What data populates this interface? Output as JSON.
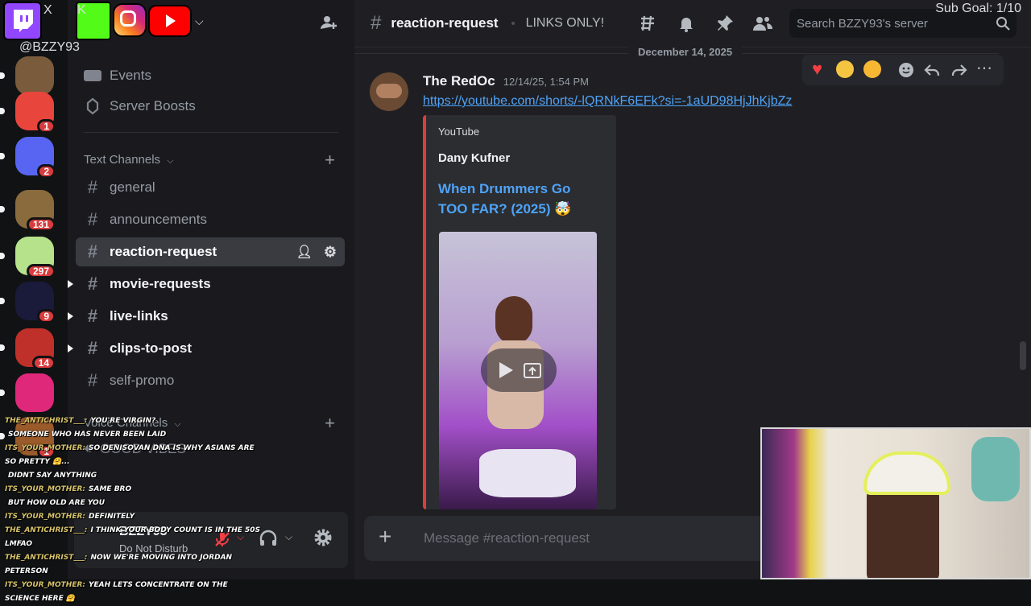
{
  "overlay": {
    "handle": "@BZZY93",
    "sub_goal": "Sub Goal: 1/10",
    "social_icons": [
      "twitch-icon",
      "x-icon",
      "kick-icon",
      "instagram-icon",
      "youtube-icon"
    ],
    "brand_colors": {
      "twitch": "#9146ff",
      "kick": "#53fc18",
      "instagram": "#e1306c",
      "youtube": "#ff0000",
      "sub_goal": "#f5e533"
    }
  },
  "servers": [
    {
      "badge": "",
      "color": "#7a5c3c"
    },
    {
      "badge": "1",
      "color": "#e8453c"
    },
    {
      "badge": "2",
      "color": "#5865f2"
    },
    {
      "badge": "131",
      "color": "#8a6b3d"
    },
    {
      "badge": "297",
      "color": "#b6e28c"
    },
    {
      "badge": "9",
      "color": "#1a1a3a"
    },
    {
      "badge": "14",
      "color": "#c0302a"
    },
    {
      "badge": "",
      "color": "#e0287a"
    },
    {
      "badge": "1",
      "color": "#9a5a2a"
    }
  ],
  "sidebar": {
    "top_items": [
      {
        "label": "Events"
      },
      {
        "label": "Server Boosts"
      }
    ],
    "text_category": "Text Channels",
    "voice_category": "Voice Channels",
    "voice_channel": "GOOD VIBES",
    "channels": [
      {
        "name": "general",
        "state": "muted"
      },
      {
        "name": "announcements",
        "state": "muted"
      },
      {
        "name": "reaction-request",
        "state": "active"
      },
      {
        "name": "movie-requests",
        "state": "unread"
      },
      {
        "name": "live-links",
        "state": "unread"
      },
      {
        "name": "clips-to-post",
        "state": "unread"
      },
      {
        "name": "self-promo",
        "state": "muted"
      }
    ],
    "user": {
      "name": "BZZY93",
      "status": "Do Not Disturb"
    }
  },
  "header": {
    "channel": "reaction-request",
    "topic": "LINKS ONLY!",
    "search_placeholder": "Search BZZY93's server"
  },
  "messages": {
    "date_divider": "December 14, 2025",
    "author": "The RedOc",
    "timestamp": "12/14/25, 1:54 PM",
    "link": "https://youtube.com/shorts/-lQRNkF6EFk?si=-1aUD98HjJhKjbZz",
    "reactions": [
      "heart-icon",
      "rofl-icon",
      "mind-blown-icon"
    ],
    "embed": {
      "provider": "YouTube",
      "author": "Dany Kufner",
      "title_line1": "When Drummers Go",
      "title_line2": "TOO FAR? (2025) 🤯"
    }
  },
  "composer": {
    "placeholder": "Message #reaction-request"
  },
  "chat_overlay": [
    {
      "user": "THE_ANTICHRIST___:",
      "text": "YOU'RE VIRGIN?"
    },
    {
      "user": "",
      "text": "SOMEONE WHO HAS NEVER BEEN LAID"
    },
    {
      "user": "ITS_YOUR_MOTHER:",
      "text": "SO DENISOVAN DNA IS WHY ASIANS ARE SO PRETTY 🤗..."
    },
    {
      "user": "",
      "text": "DIDNT SAY ANYTHING"
    },
    {
      "user": "ITS_YOUR_MOTHER:",
      "text": "SAME BRO"
    },
    {
      "user": "",
      "text": "BUT HOW OLD ARE YOU"
    },
    {
      "user": "ITS_YOUR_MOTHER:",
      "text": "DEFINITELY"
    },
    {
      "user": "THE_ANTICHRIST___:",
      "text": "I THINK YOUR BODY COUNT IS IN THE 50S LMFAO"
    },
    {
      "user": "THE_ANTICHRIST___:",
      "text": "NOW WE'RE MOVING INTO JORDAN PETERSON"
    },
    {
      "user": "ITS_YOUR_MOTHER:",
      "text": "YEAH LETS CONCENTRATE ON THE SCIENCE HERE 🤗"
    }
  ]
}
